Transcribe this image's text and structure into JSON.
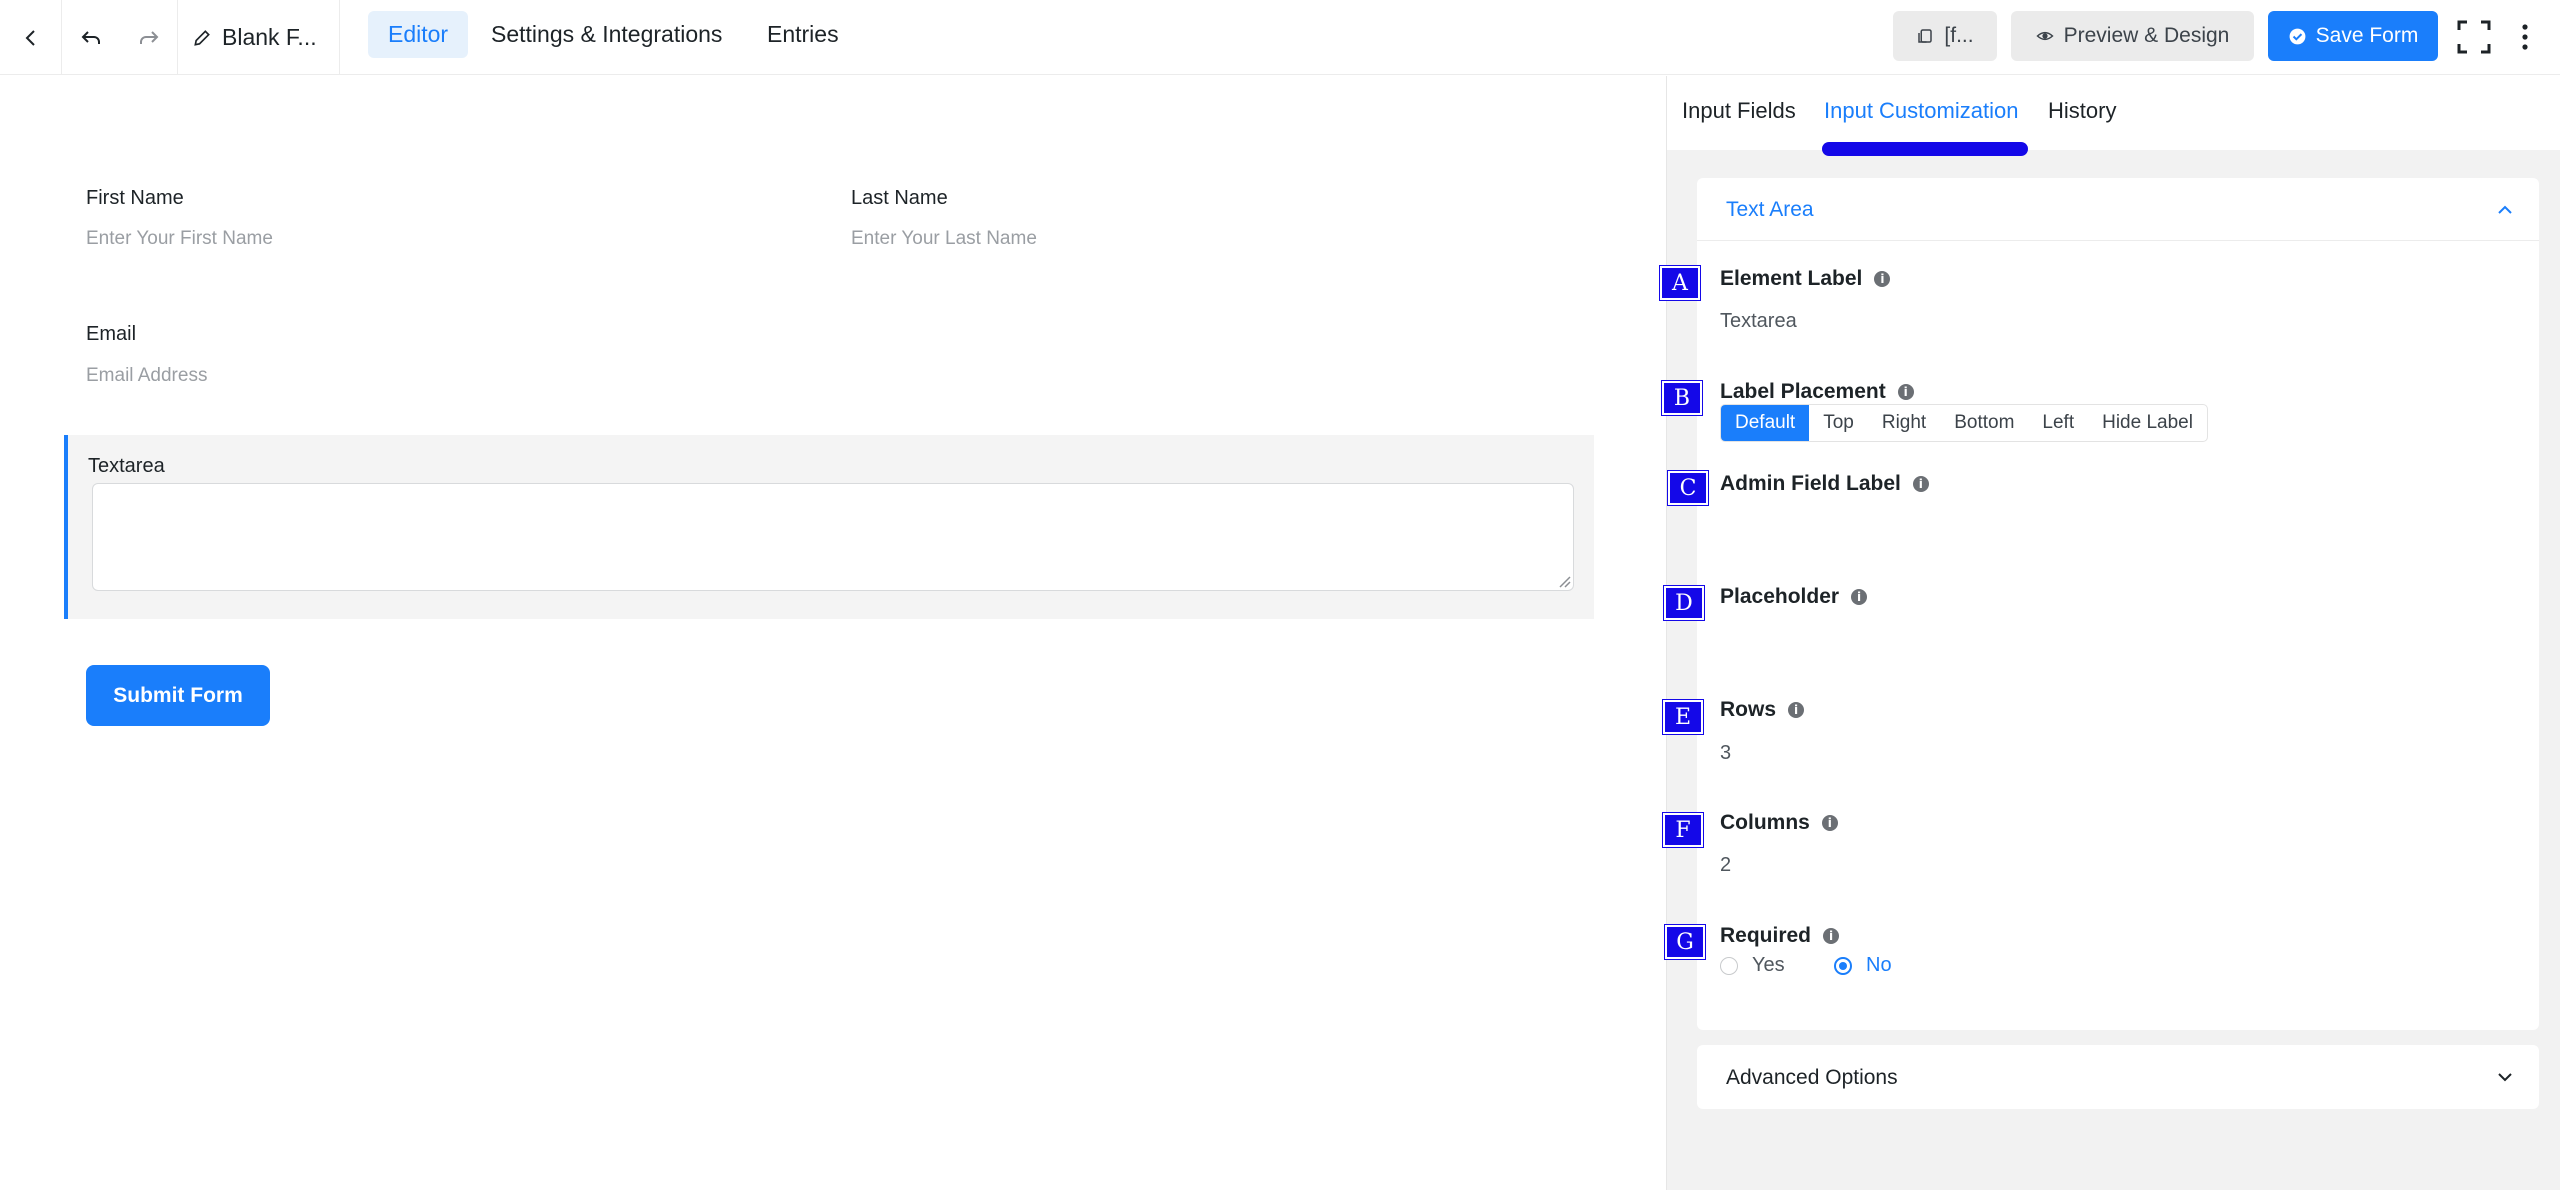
{
  "header": {
    "form_name": "Blank F...",
    "tabs": [
      "Editor",
      "Settings & Integrations",
      "Entries"
    ],
    "shortcode_label": "[f...",
    "preview_label": "Preview & Design",
    "save_label": "Save Form"
  },
  "form": {
    "first_name_label": "First Name",
    "first_name_placeholder": "Enter Your First Name",
    "last_name_label": "Last Name",
    "last_name_placeholder": "Enter Your Last Name",
    "email_label": "Email",
    "email_placeholder": "Email Address",
    "textarea_label": "Textarea",
    "submit_label": "Submit Form"
  },
  "panel": {
    "tabs": [
      "Input Fields",
      "Input Customization",
      "History"
    ],
    "section_title": "Text Area",
    "element_label": {
      "label": "Element Label",
      "value": "Textarea"
    },
    "label_placement": {
      "label": "Label Placement",
      "options": [
        "Default",
        "Top",
        "Right",
        "Bottom",
        "Left",
        "Hide Label"
      ],
      "selected": "Default"
    },
    "admin_field_label": {
      "label": "Admin Field Label",
      "value": ""
    },
    "placeholder": {
      "label": "Placeholder",
      "value": ""
    },
    "rows": {
      "label": "Rows",
      "value": "3"
    },
    "columns": {
      "label": "Columns",
      "value": "2"
    },
    "required": {
      "label": "Required",
      "yes": "Yes",
      "no": "No",
      "selected": "No"
    },
    "advanced_title": "Advanced Options"
  },
  "markers": [
    "A",
    "B",
    "C",
    "D",
    "E",
    "F",
    "G"
  ],
  "colors": {
    "accent": "#1a7efb",
    "marker": "#1408e8"
  }
}
